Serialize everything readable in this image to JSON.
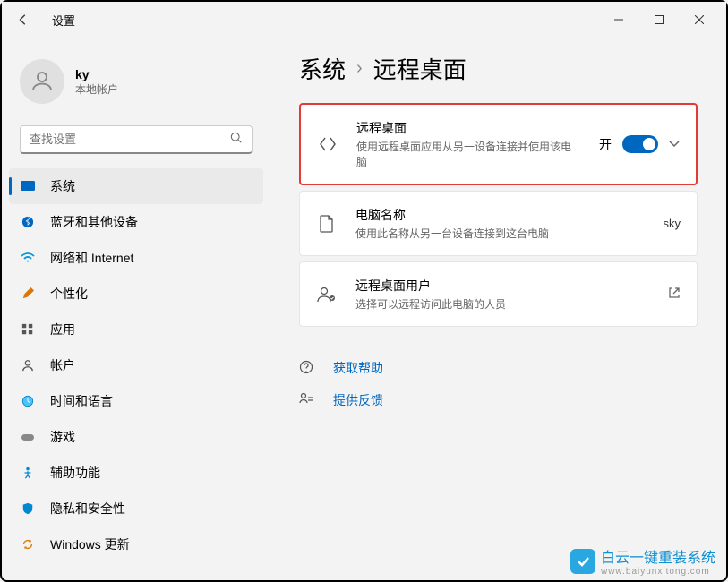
{
  "window": {
    "title": "设置"
  },
  "user": {
    "name": "ky",
    "type": "本地帐户"
  },
  "search": {
    "placeholder": "查找设置"
  },
  "nav": {
    "items": [
      {
        "label": "系统"
      },
      {
        "label": "蓝牙和其他设备"
      },
      {
        "label": "网络和 Internet"
      },
      {
        "label": "个性化"
      },
      {
        "label": "应用"
      },
      {
        "label": "帐户"
      },
      {
        "label": "时间和语言"
      },
      {
        "label": "游戏"
      },
      {
        "label": "辅助功能"
      },
      {
        "label": "隐私和安全性"
      },
      {
        "label": "Windows 更新"
      }
    ]
  },
  "breadcrumb": {
    "parent": "系统",
    "current": "远程桌面"
  },
  "cards": {
    "remote": {
      "title": "远程桌面",
      "desc": "使用远程桌面应用从另一设备连接并使用该电脑",
      "toggle_label": "开"
    },
    "pcname": {
      "title": "电脑名称",
      "desc": "使用此名称从另一台设备连接到这台电脑",
      "value": "sky"
    },
    "users": {
      "title": "远程桌面用户",
      "desc": "选择可以远程访问此电脑的人员"
    }
  },
  "links": {
    "help": "获取帮助",
    "feedback": "提供反馈"
  },
  "watermark": {
    "text": "白云一键重装系统",
    "url": "www.baiyunxitong.com"
  }
}
